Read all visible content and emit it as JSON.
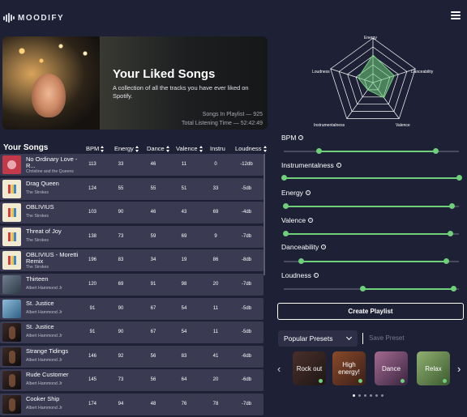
{
  "app": {
    "name": "MOODIFY"
  },
  "hero": {
    "title": "Your Liked Songs",
    "description": "A collection of all the tracks you have ever liked on Spotify.",
    "songs_in_playlist": "Songs In Playlist — 925",
    "total_listening_time": "Total Listening Time — 52:42:49"
  },
  "table": {
    "heading": "Your Songs",
    "columns": [
      "BPM",
      "Energy",
      "Dance",
      "Valence",
      "Instru",
      "Loudness"
    ],
    "rows": [
      {
        "title": "No Ordinary Love - R...",
        "artist": "Christine and the Queens",
        "art": "red",
        "bpm": "113",
        "energy": "33",
        "dance": "46",
        "valence": "11",
        "instru": "0",
        "loudness": "-12db"
      },
      {
        "title": "Drag Queen",
        "artist": "The Strokes",
        "art": "strokes",
        "bpm": "124",
        "energy": "55",
        "dance": "55",
        "valence": "51",
        "instru": "33",
        "loudness": "-5db"
      },
      {
        "title": "OBLIVIUS",
        "artist": "The Strokes",
        "art": "strokes",
        "bpm": "103",
        "energy": "90",
        "dance": "46",
        "valence": "43",
        "instru": "69",
        "loudness": "-4db"
      },
      {
        "title": "Threat of Joy",
        "artist": "The Strokes",
        "art": "strokes",
        "bpm": "138",
        "energy": "73",
        "dance": "59",
        "valence": "69",
        "instru": "9",
        "loudness": "-7db"
      },
      {
        "title": "OBLIVIUS - Moretti Remix",
        "artist": "The Strokes",
        "art": "strokes",
        "bpm": "196",
        "energy": "83",
        "dance": "34",
        "valence": "19",
        "instru": "86",
        "loudness": "-8db"
      },
      {
        "title": "Thirteen",
        "artist": "Albert Hammond Jr",
        "art": "gray",
        "bpm": "120",
        "energy": "69",
        "dance": "91",
        "valence": "98",
        "instru": "20",
        "loudness": "-7db"
      },
      {
        "title": "St. Justice",
        "artist": "Albert Hammond Jr",
        "art": "blue",
        "bpm": "91",
        "energy": "90",
        "dance": "67",
        "valence": "54",
        "instru": "11",
        "loudness": "-5db"
      },
      {
        "title": "St. Justice",
        "artist": "Albert Hammond Jr",
        "art": "dark",
        "bpm": "91",
        "energy": "90",
        "dance": "67",
        "valence": "54",
        "instru": "11",
        "loudness": "-5db"
      },
      {
        "title": "Strange Tidings",
        "artist": "Albert Hammond Jr",
        "art": "dark",
        "bpm": "146",
        "energy": "92",
        "dance": "56",
        "valence": "83",
        "instru": "41",
        "loudness": "-6db"
      },
      {
        "title": "Rude Customer",
        "artist": "Albert Hammond Jr",
        "art": "dark",
        "bpm": "145",
        "energy": "73",
        "dance": "56",
        "valence": "64",
        "instru": "20",
        "loudness": "-6db"
      },
      {
        "title": "Cooker Ship",
        "artist": "Albert Hammond Jr",
        "art": "dark",
        "bpm": "174",
        "energy": "94",
        "dance": "48",
        "valence": "76",
        "instru": "78",
        "loudness": "-7db"
      }
    ]
  },
  "radar": {
    "labels": {
      "energy": "Energy",
      "danceability": "Danceability",
      "valence": "Valence",
      "instrumentalness": "Instrumentalness",
      "loudness": "Loudness"
    }
  },
  "filters": [
    {
      "label": "BPM",
      "low": 0.2,
      "high": 0.87
    },
    {
      "label": "Instrumentalness",
      "low": 0.0,
      "high": 1.0
    },
    {
      "label": "Energy",
      "low": 0.01,
      "high": 0.96
    },
    {
      "label": "Valence",
      "low": 0.01,
      "high": 0.95
    },
    {
      "label": "Danceability",
      "low": 0.1,
      "high": 0.93
    },
    {
      "label": "Loudness",
      "low": 0.45,
      "high": 0.97
    }
  ],
  "actions": {
    "create_playlist": "Create Playlist",
    "save_preset": "Save Preset"
  },
  "presets": {
    "dropdown_label": "Popular Presets",
    "items": [
      {
        "label": "Rock out"
      },
      {
        "label": "High energy!"
      },
      {
        "label": "Dance"
      },
      {
        "label": "Relax"
      }
    ],
    "page_count": 6,
    "active_page": 0
  },
  "colors": {
    "background": "#1e2035",
    "accent": "#6fd07a",
    "row": "#3a3a52"
  }
}
